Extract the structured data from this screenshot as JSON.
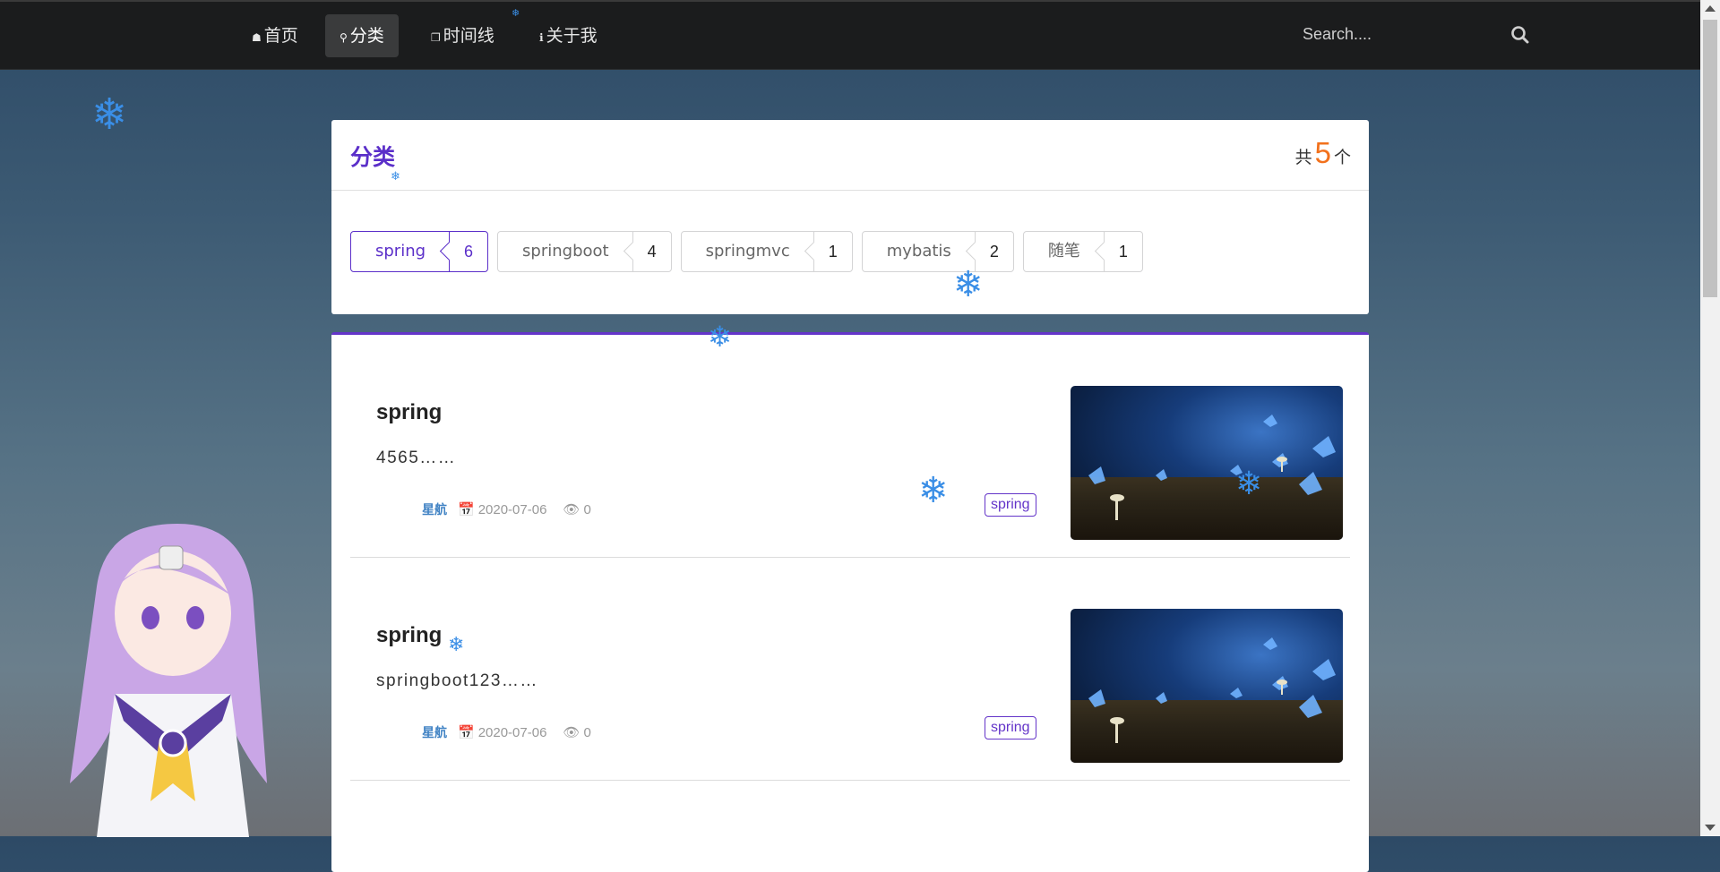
{
  "nav": {
    "items": [
      {
        "icon": "home-icon",
        "label": "首页"
      },
      {
        "icon": "location-pin-icon",
        "label": "分类"
      },
      {
        "icon": "clone-icon",
        "label": "时间线"
      },
      {
        "icon": "info-icon",
        "label": "关于我"
      }
    ],
    "active_index": 1,
    "search_placeholder": "Search...."
  },
  "categories": {
    "title": "分类",
    "count_prefix": "共",
    "count": "5",
    "count_suffix": "个",
    "items": [
      {
        "name": "spring",
        "count": "6",
        "active": true
      },
      {
        "name": "springboot",
        "count": "4",
        "active": false
      },
      {
        "name": "springmvc",
        "count": "1",
        "active": false
      },
      {
        "name": "mybatis",
        "count": "2",
        "active": false
      },
      {
        "name": "随笔",
        "count": "1",
        "active": false
      }
    ]
  },
  "posts": [
    {
      "title": "spring",
      "excerpt": "4565……",
      "author": "星航",
      "date": "2020-07-06",
      "views": "0",
      "tag": "spring"
    },
    {
      "title": "spring",
      "excerpt": "springboot123……",
      "author": "星航",
      "date": "2020-07-06",
      "views": "0",
      "tag": "spring"
    }
  ],
  "colors": {
    "accent": "#6435c9",
    "count_highlight": "#f2711c",
    "author": "#4183c4",
    "nav_bg": "#1b1c1d"
  }
}
